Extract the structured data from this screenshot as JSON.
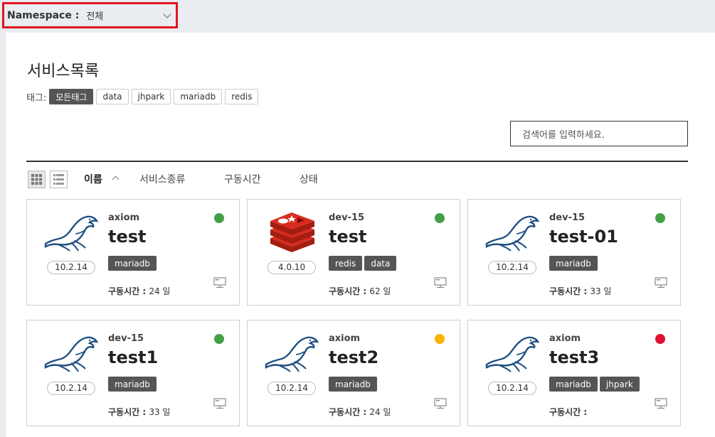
{
  "namespace": {
    "label": "Namespace :",
    "value": "전체"
  },
  "page": {
    "title": "서비스목록"
  },
  "tags": {
    "label": "태그:",
    "items": [
      "모든태그",
      "data",
      "jhpark",
      "mariadb",
      "redis"
    ]
  },
  "search": {
    "placeholder": "검색어를 입력하세요."
  },
  "sort": {
    "items": [
      "이름",
      "서비스종류",
      "구동시간",
      "상태"
    ]
  },
  "uptime_label": "구동시간 :",
  "status_colors": {
    "running": "#43a047",
    "warning": "#f9b200",
    "stopped": "#e0102f"
  },
  "cards": [
    {
      "ns": "axiom",
      "name": "test",
      "version": "10.2.14",
      "logo": "mariadb-seal-icon",
      "tags": [
        "mariadb"
      ],
      "uptime": "24 일",
      "status": "running"
    },
    {
      "ns": "dev-15",
      "name": "test",
      "version": "4.0.10",
      "logo": "redis-cube-icon",
      "tags": [
        "redis",
        "data"
      ],
      "uptime": "62 일",
      "status": "running"
    },
    {
      "ns": "dev-15",
      "name": "test-01",
      "version": "10.2.14",
      "logo": "mariadb-seal-icon",
      "tags": [
        "mariadb"
      ],
      "uptime": "33 일",
      "status": "running"
    },
    {
      "ns": "dev-15",
      "name": "test1",
      "version": "10.2.14",
      "logo": "mariadb-seal-icon",
      "tags": [
        "mariadb"
      ],
      "uptime": "33 일",
      "status": "running"
    },
    {
      "ns": "axiom",
      "name": "test2",
      "version": "10.2.14",
      "logo": "mariadb-seal-icon",
      "tags": [
        "mariadb"
      ],
      "uptime": "24 일",
      "status": "warning"
    },
    {
      "ns": "axiom",
      "name": "test3",
      "version": "10.2.14",
      "logo": "mariadb-seal-icon",
      "tags": [
        "mariadb",
        "jhpark"
      ],
      "uptime": "",
      "status": "stopped"
    }
  ]
}
